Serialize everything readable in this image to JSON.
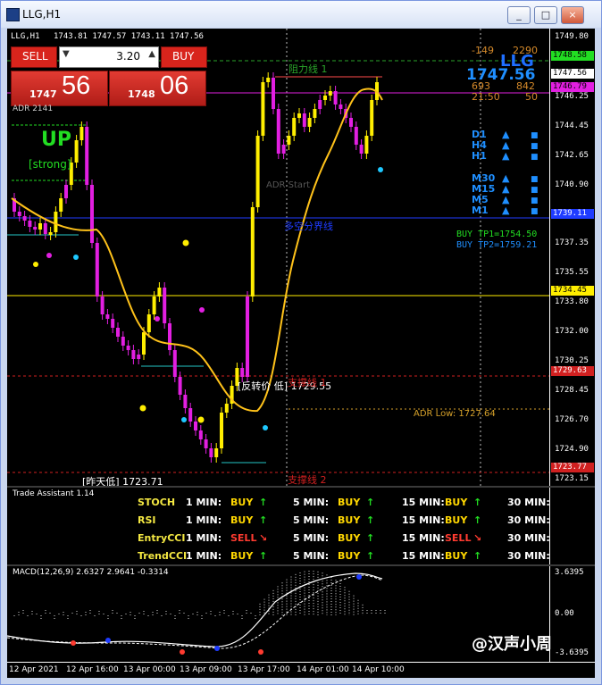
{
  "window": {
    "title": "LLG,H1",
    "controls": [
      "_",
      "□",
      "×"
    ]
  },
  "chart_header": {
    "symbol_line": "LLG,H1",
    "ohlc": "1743.81 1747.57 1743.11 1747.56"
  },
  "trade_panel": {
    "sell_label": "SELL",
    "buy_label": "BUY",
    "lot": "3.20",
    "sell_price_small": "1747",
    "sell_price_big": "56",
    "buy_price_small": "1748",
    "buy_price_big": "06"
  },
  "indicator_labels": {
    "adr": "ADR 2141",
    "trend_up": "UP",
    "strength": "[strong]",
    "resistance1": "阻力线 1",
    "adr_start": "ADR Start",
    "support_line": "多空分界线",
    "reversal_low": "[反转价 低] 1729.55",
    "support1": "支撑线 1",
    "adr_low": "ADR Low: 1727.64",
    "prev_low": "[昨天低] 1723.71",
    "support2": "支撑线 2"
  },
  "info_panel": {
    "val_neg": "-149",
    "val_2290": "2290",
    "symbol": "LLG",
    "price": "1747.56",
    "v693": "693",
    "v842": "842",
    "time": "21:50",
    "v50": "50",
    "timeframes": [
      "D1",
      "H4",
      "H1",
      "M30",
      "M15",
      "M5",
      "M1"
    ],
    "tp1": "BUY TP1=1754.50",
    "tp2": "BUY TP2=1759.21"
  },
  "price_scale": {
    "ticks": [
      "1749.80",
      "1748.58",
      "1747.56",
      "1746.79",
      "1746.25",
      "1744.45",
      "1742.65",
      "1740.90",
      "1739.11",
      "1737.35",
      "1735.55",
      "1734.45",
      "1733.80",
      "1732.00",
      "1730.25",
      "1729.63",
      "1728.45",
      "1726.70",
      "1724.90",
      "1723.77",
      "1723.15"
    ]
  },
  "trade_assistant": {
    "title": "Trade Assistant 1.14",
    "rows": [
      {
        "name": "STOCH",
        "m1": "BUY",
        "m5": "BUY",
        "m15": "BUY",
        "m1dir": "↑",
        "m5dir": "↑",
        "m15dir": "↑"
      },
      {
        "name": "RSI",
        "m1": "BUY",
        "m5": "BUY",
        "m15": "BUY",
        "m1dir": "↑",
        "m5dir": "↑",
        "m15dir": "↑"
      },
      {
        "name": "EntryCCI",
        "m1": "SELL",
        "m5": "BUY",
        "m15": "SELL",
        "m1dir": "↘",
        "m5dir": "↑",
        "m15dir": "↘"
      },
      {
        "name": "TrendCCI",
        "m1": "BUY",
        "m5": "BUY",
        "m15": "BUY",
        "m1dir": "↑",
        "m5dir": "↑",
        "m15dir": "↑"
      }
    ],
    "tf1": "1 MIN:",
    "tf5": "5 MIN:",
    "tf15": "15 MIN:",
    "tf30": "30 MIN:"
  },
  "macd": {
    "label": "MACD(12,26,9) 2.6327 2.9641 -0.3314",
    "scale_top": "3.6395",
    "scale_mid": "0.00",
    "scale_bot": "-3.6395"
  },
  "time_scale": [
    "12 Apr 2021",
    "12 Apr 16:00",
    "13 Apr 00:00",
    "13 Apr 09:00",
    "13 Apr 17:00",
    "14 Apr 01:00",
    "14 Apr 10:00"
  ],
  "watermark": "@汉声小周",
  "colors": {
    "sell": "#d8241c",
    "buy": "#ffd700",
    "magenta": "#e21fe1",
    "ma": "#ffc21a"
  }
}
